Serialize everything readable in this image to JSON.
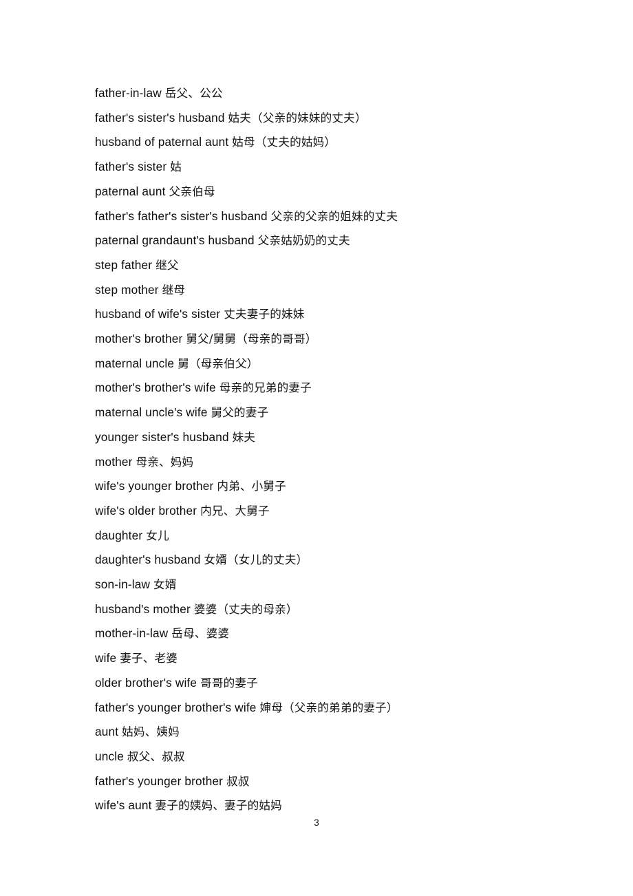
{
  "document": {
    "page_number": "3",
    "lines": [
      {
        "term": "father-in-law",
        "gloss": "岳父、公公"
      },
      {
        "term": "father's sister's husband",
        "gloss": "姑夫（父亲的妹妹的丈夫）"
      },
      {
        "term": "husband of paternal aunt",
        "gloss": "姑母（丈夫的姑妈）"
      },
      {
        "term": "father's sister",
        "gloss": "姑"
      },
      {
        "term": "paternal aunt",
        "gloss": "父亲伯母"
      },
      {
        "term": "father's father's sister's husband",
        "gloss": "父亲的父亲的姐妹的丈夫"
      },
      {
        "term": "paternal grandaunt's husband",
        "gloss": "父亲姑奶奶的丈夫"
      },
      {
        "term": "step father",
        "gloss": "继父"
      },
      {
        "term": "step mother",
        "gloss": "继母"
      },
      {
        "term": "husband of wife's sister",
        "gloss": "丈夫妻子的妹妹"
      },
      {
        "term": "mother's brother",
        "gloss": "舅父/舅舅（母亲的哥哥）"
      },
      {
        "term": "maternal uncle",
        "gloss": "舅（母亲伯父）"
      },
      {
        "term": "mother's brother's wife",
        "gloss": "母亲的兄弟的妻子"
      },
      {
        "term": "maternal uncle's wife",
        "gloss": "舅父的妻子"
      },
      {
        "term": "younger sister's husband",
        "gloss": "妹夫"
      },
      {
        "term": "mother",
        "gloss": "母亲、妈妈"
      },
      {
        "term": "wife's younger brother",
        "gloss": "内弟、小舅子"
      },
      {
        "term": "wife's older brother",
        "gloss": "内兄、大舅子"
      },
      {
        "term": "daughter",
        "gloss": "女儿"
      },
      {
        "term": "daughter's husband",
        "gloss": "女婿（女儿的丈夫）"
      },
      {
        "term": "son-in-law",
        "gloss": "女婿"
      },
      {
        "term": "husband's mother",
        "gloss": "婆婆（丈夫的母亲）"
      },
      {
        "term": "mother-in-law",
        "gloss": "岳母、婆婆"
      },
      {
        "term": "wife",
        "gloss": "妻子、老婆"
      },
      {
        "term": "older brother's wife",
        "gloss": "哥哥的妻子"
      },
      {
        "term": "father's younger brother's wife",
        "gloss": "婶母（父亲的弟弟的妻子）"
      },
      {
        "term": "aunt",
        "gloss": "姑妈、姨妈"
      },
      {
        "term": "uncle",
        "gloss": "叔父、叔叔"
      },
      {
        "term": "father's younger brother",
        "gloss": "叔叔"
      },
      {
        "term": "wife's aunt",
        "gloss": "妻子的姨妈、妻子的姑妈"
      }
    ]
  }
}
